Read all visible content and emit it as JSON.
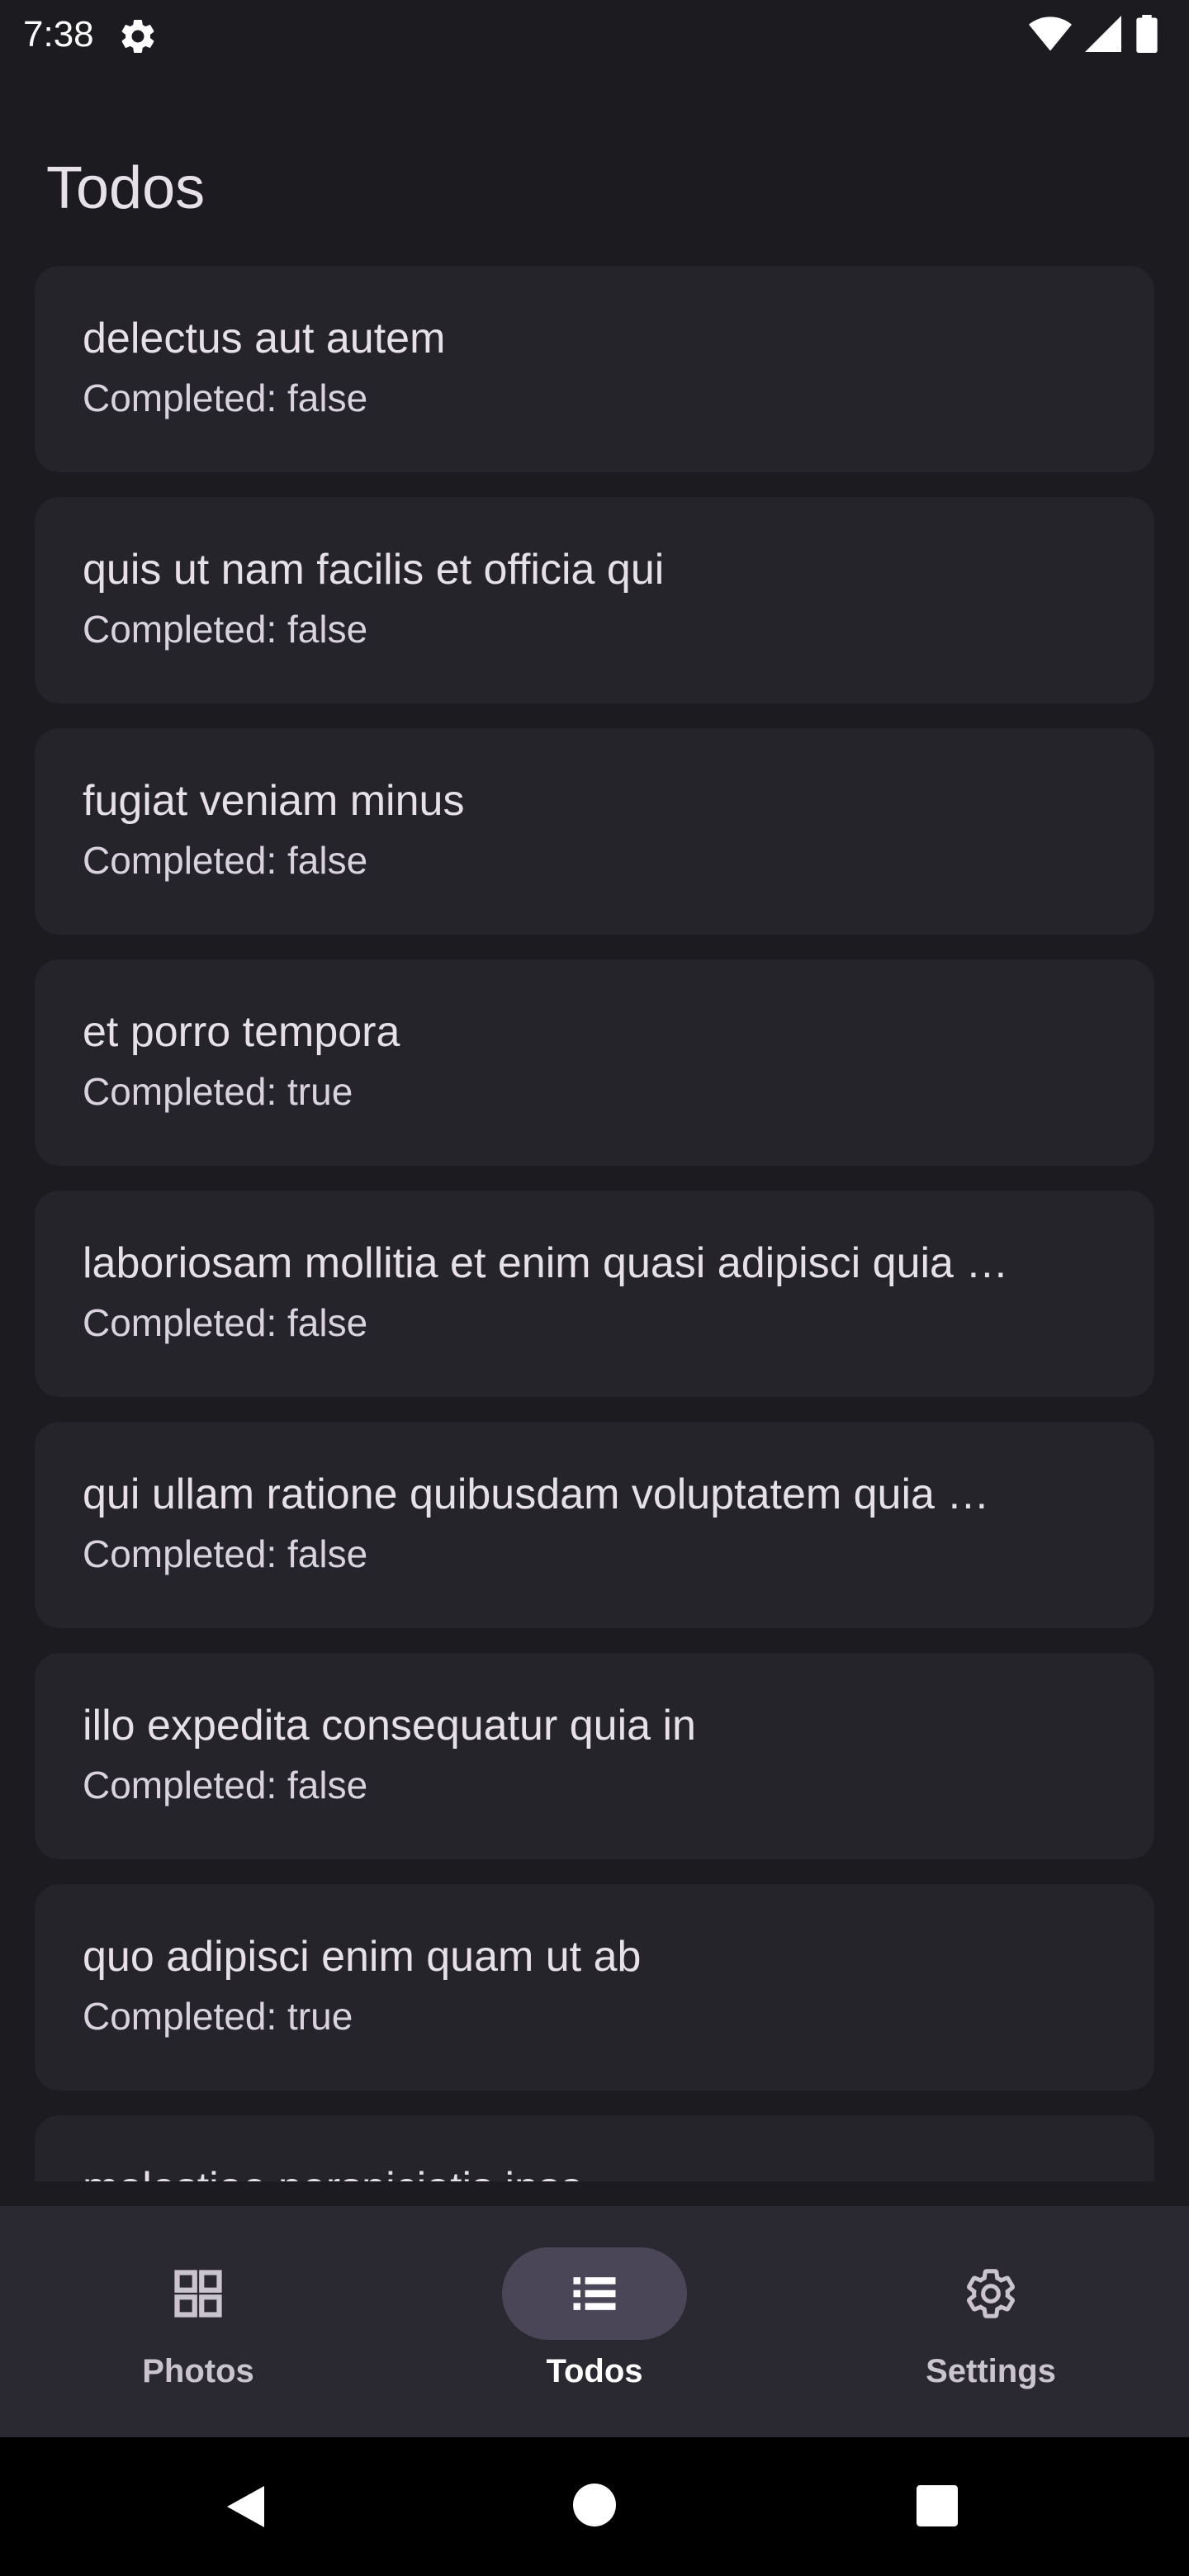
{
  "status_bar": {
    "time": "7:38",
    "left_icon": "gear-icon",
    "right_icons": [
      "wifi-icon",
      "cellular-signal-icon",
      "battery-icon"
    ]
  },
  "header": {
    "title": "Todos"
  },
  "todos": [
    {
      "title": "delectus aut autem",
      "status": "Completed: false"
    },
    {
      "title": "quis ut nam facilis et officia qui",
      "status": "Completed: false"
    },
    {
      "title": "fugiat veniam minus",
      "status": "Completed: false"
    },
    {
      "title": "et porro tempora",
      "status": "Completed: true"
    },
    {
      "title": "laboriosam mollitia et enim quasi adipisci quia …",
      "status": "Completed: false"
    },
    {
      "title": "qui ullam ratione quibusdam voluptatem quia …",
      "status": "Completed: false"
    },
    {
      "title": "illo expedita consequatur quia in",
      "status": "Completed: false"
    },
    {
      "title": "quo adipisci enim quam ut ab",
      "status": "Completed: true"
    },
    {
      "title": "molestiae perspiciatis ipsa",
      "status": ""
    }
  ],
  "bottom_nav": {
    "items": [
      {
        "label": "Photos",
        "icon": "grid-icon",
        "active": false
      },
      {
        "label": "Todos",
        "icon": "list-icon",
        "active": true
      },
      {
        "label": "Settings",
        "icon": "gear-icon",
        "active": false
      }
    ]
  },
  "system_nav": {
    "icons": [
      "back-icon",
      "home-icon",
      "recents-icon"
    ]
  },
  "colors": {
    "background": "#1c1b20",
    "card": "#25242a",
    "nav_background": "#2a2830",
    "active_pill": "#4a4658",
    "text_primary": "#e6e1e8",
    "text_secondary": "#d8d3dc"
  }
}
